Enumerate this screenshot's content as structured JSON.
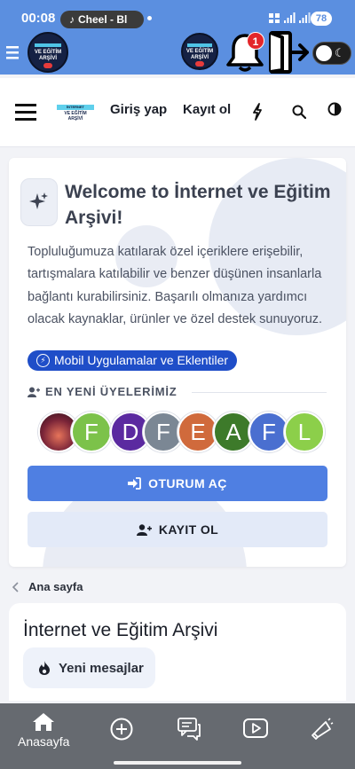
{
  "status_bar": {
    "time": "00:08",
    "now_playing": "Cheel - Bl",
    "battery": "78"
  },
  "app_bar": {
    "notifications_count": "1"
  },
  "top_nav": {
    "login_label": "Giriş yap",
    "register_label": "Kayıt ol"
  },
  "welcome": {
    "title": "Welcome to İnternet ve Eğitim Arşivi!",
    "description": "Topluluğumuza katılarak özel içeriklere erişebilir, tartışmalara katılabilir ve benzer düşünen insanlarla bağlantı kurabilirsiniz. Başarılı olmanıza yardımcı olacak kaynaklar, ürünler ve özel destek sunuyoruz.",
    "mobile_apps_link": "Mobil Uygulamalar ve Eklentiler",
    "newest_members_header": "EN YENİ ÜYELERİMİZ",
    "members": [
      {
        "letter": "",
        "color": "#8a3a4a"
      },
      {
        "letter": "F",
        "color": "#7cc24a"
      },
      {
        "letter": "D",
        "color": "#5b2aa0"
      },
      {
        "letter": "F",
        "color": "#7b8794"
      },
      {
        "letter": "E",
        "color": "#d06a3c"
      },
      {
        "letter": "A",
        "color": "#3d7a2a"
      },
      {
        "letter": "F",
        "color": "#4a6fd0"
      },
      {
        "letter": "L",
        "color": "#8ccf4a"
      }
    ],
    "login_button": "OTURUM AÇ",
    "register_button": "KAYIT OL"
  },
  "breadcrumb": {
    "home_label": "Ana sayfa"
  },
  "forum": {
    "title": "İnternet ve Eğitim Arşivi",
    "new_posts_button": "Yeni mesajlar"
  },
  "tab_bar": {
    "home_label": "Anasayfa"
  },
  "logo_text": "İNTERNET VE EĞİTİM ARŞİVİ",
  "colors": {
    "app_bar": "#5b8fe0",
    "primary_button": "#4f7fe2",
    "mobile_link": "#1f4ec8",
    "tab_bar": "#666a70"
  }
}
